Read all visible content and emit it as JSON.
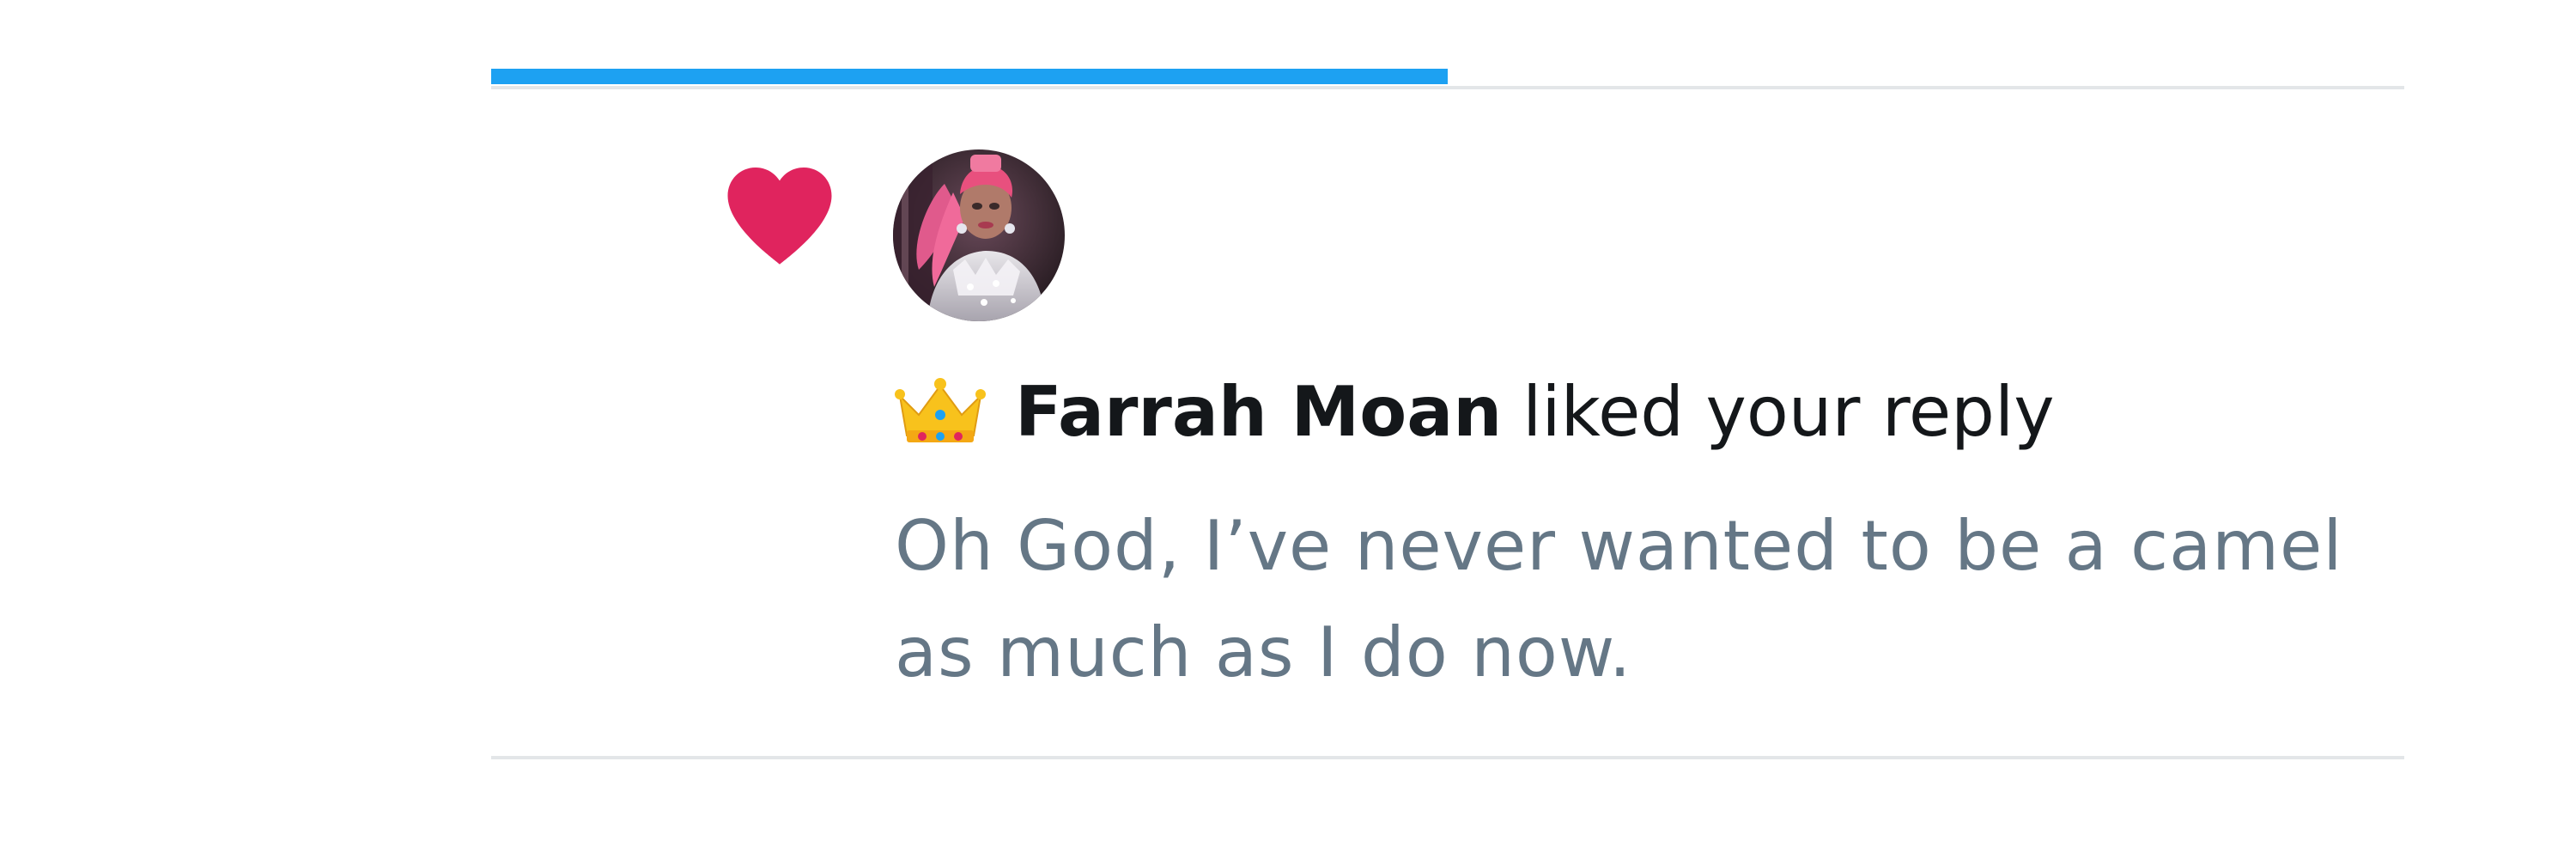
{
  "tabs": {
    "active_index": 0,
    "count": 2,
    "active_fraction": 0.5
  },
  "notification": {
    "type_icon": "heart-icon",
    "user_badge_icon": "crown-icon",
    "avatar_icon": "user-avatar",
    "user_name": "Farrah Moan",
    "action": "liked your reply",
    "tweet_text": "Oh God, I’ve never wanted to be a camel as much as I do now."
  },
  "colors": {
    "accent": "#1da1f2",
    "like": "#e0245e",
    "primary_text": "#14171a",
    "secondary_text": "#657786",
    "divider": "#e3e6e8"
  }
}
